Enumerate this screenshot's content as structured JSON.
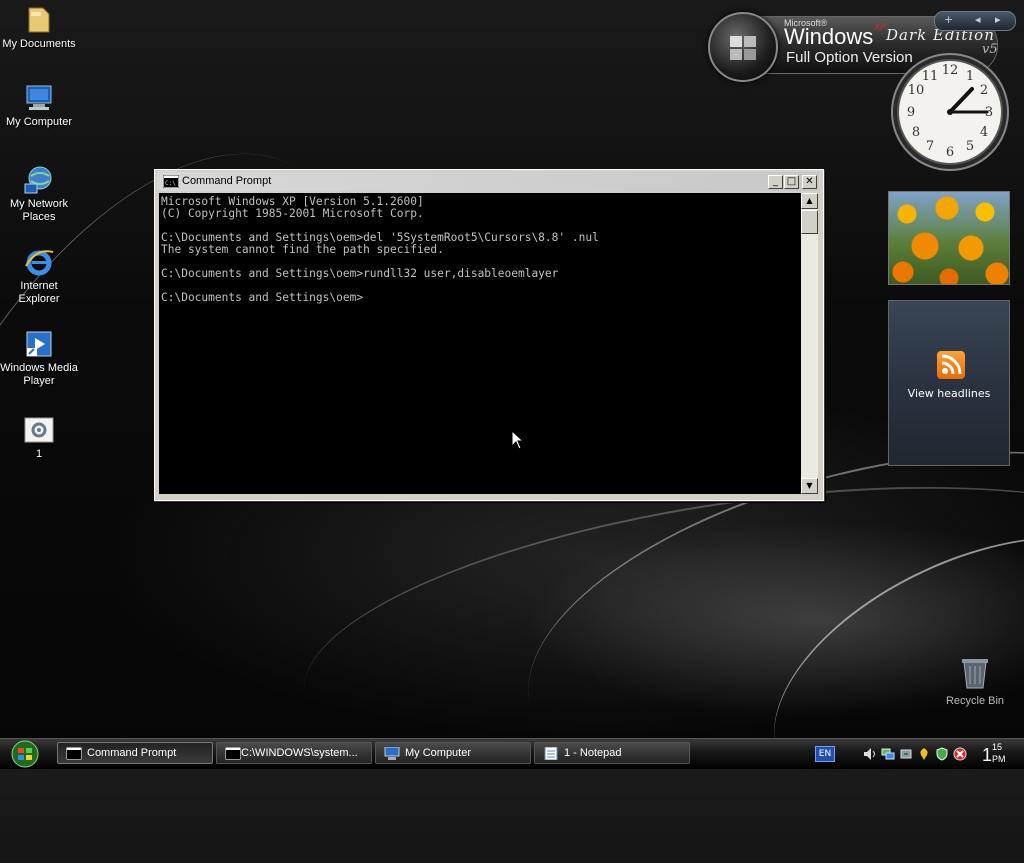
{
  "desktop": {
    "icons": [
      {
        "label": "My Documents"
      },
      {
        "label": "My Computer"
      },
      {
        "label": "My Network Places"
      },
      {
        "label": "Internet Explorer"
      },
      {
        "label": "Windows Media Player"
      },
      {
        "label": "1"
      }
    ],
    "recycle_bin": "Recycle Bin"
  },
  "branding": {
    "microsoft": "Microsoft®",
    "windows": "Windows",
    "xp": "XP",
    "edition": "Dark Edition",
    "version_tag": "v5",
    "full_option": "Full Option Version"
  },
  "sidebar": {
    "add_glyph": "+",
    "prev_glyph": "◂",
    "next_glyph": "▸",
    "feed_label": "View headlines"
  },
  "command_prompt": {
    "title": "Command Prompt",
    "minimize": "_",
    "maximize": "□",
    "close": "✕",
    "scroll_up": "▲",
    "scroll_down": "▼",
    "output": "Microsoft Windows XP [Version 5.1.2600]\n(C) Copyright 1985-2001 Microsoft Corp.\n\nC:\\Documents and Settings\\oem>del '5SystemRoot5\\Cursors\\8.8' .nul\nThe system cannot find the path specified.\n\nC:\\Documents and Settings\\oem>rundll32 user,disableoemlayer\n\nC:\\Documents and Settings\\oem>"
  },
  "taskbar": {
    "tasks": [
      {
        "label": "Command Prompt"
      },
      {
        "label": "C:\\WINDOWS\\system..."
      },
      {
        "label": "My Computer"
      },
      {
        "label": "1 - Notepad"
      }
    ],
    "language": "EN",
    "clock": {
      "hour": "1",
      "minute": "15",
      "ampm": "PM"
    }
  },
  "colors": {
    "console_bg": "#000000",
    "console_text": "#c0c0c0",
    "rss_orange": "#f28a1a"
  }
}
